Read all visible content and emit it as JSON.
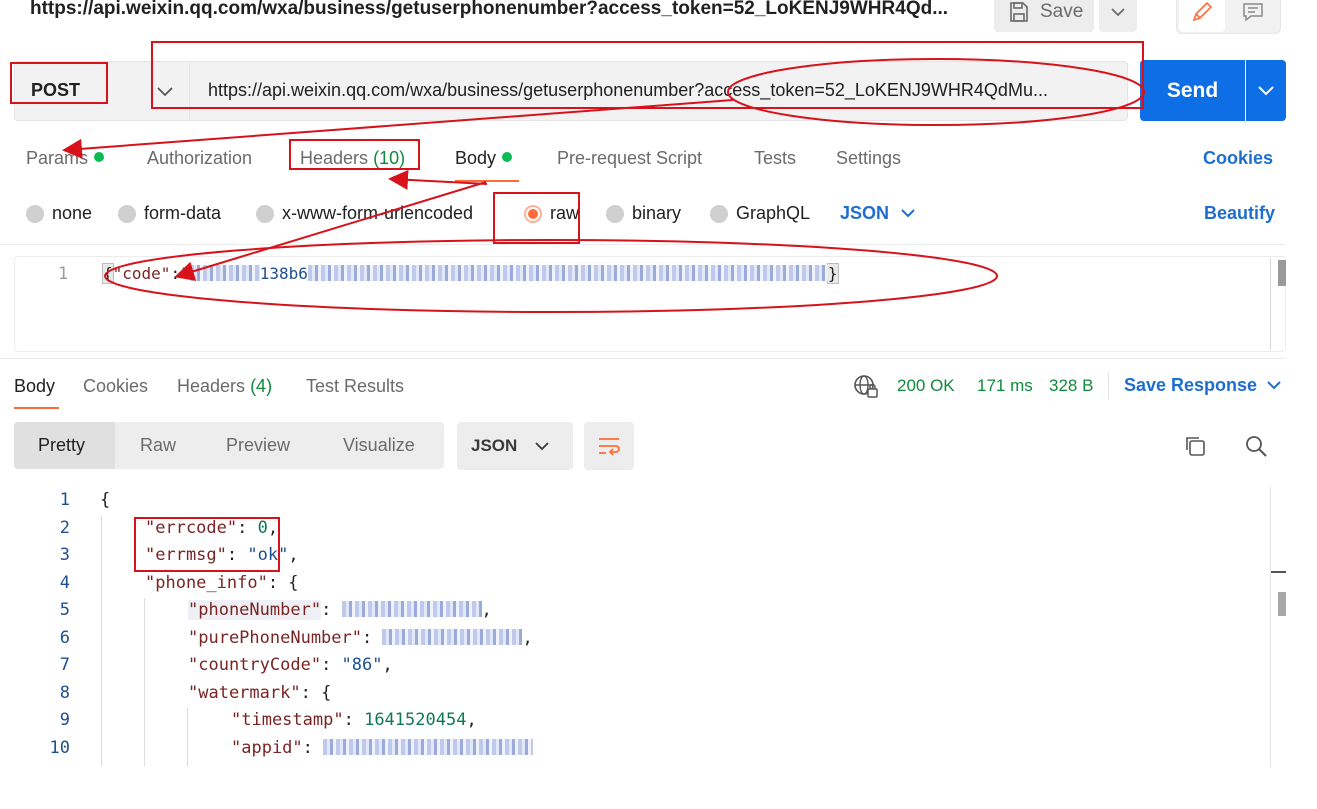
{
  "request_title": "https://api.weixin.qq.com/wxa/business/getuserphonenumber?access_token=52_LoKENJ9WHR4Qd...",
  "toolbar": {
    "save_label": "Save"
  },
  "request": {
    "method": "POST",
    "url": "https://api.weixin.qq.com/wxa/business/getuserphonenumber?access_token=52_LoKENJ9WHR4QdMu...",
    "send_label": "Send"
  },
  "request_tabs": {
    "params": "Params",
    "authorization": "Authorization",
    "headers": "Headers",
    "headers_count": "(10)",
    "body": "Body",
    "pre_request": "Pre-request Script",
    "tests": "Tests",
    "settings": "Settings",
    "cookies": "Cookies"
  },
  "body_types": {
    "none": "none",
    "form_data": "form-data",
    "urlencoded": "x-www-form-urlencoded",
    "raw": "raw",
    "binary": "binary",
    "graphql": "GraphQL",
    "format": "JSON",
    "beautify": "Beautify"
  },
  "request_body": {
    "line_number": "1",
    "open": "{",
    "key": "\"code\"",
    "colon": ":",
    "value_start": "\"",
    "value_visible": "138b6",
    "close": "}"
  },
  "response_tabs": {
    "body": "Body",
    "cookies": "Cookies",
    "headers": "Headers",
    "headers_count": "(4)",
    "test_results": "Test Results"
  },
  "response_status": {
    "status": "200 OK",
    "time": "171 ms",
    "size": "328 B",
    "save_response": "Save Response"
  },
  "response_view": {
    "pretty": "Pretty",
    "raw": "Raw",
    "preview": "Preview",
    "visualize": "Visualize",
    "format": "JSON"
  },
  "response_body": {
    "line_numbers": [
      "1",
      "2",
      "3",
      "4",
      "5",
      "6",
      "7",
      "8",
      "9",
      "10"
    ],
    "brace_open": "{",
    "errcode_key": "\"errcode\"",
    "errcode_value": "0",
    "errmsg_key": "\"errmsg\"",
    "errmsg_value": "\"ok\"",
    "phone_info_key": "\"phone_info\"",
    "phone_number_key": "\"phoneNumber\"",
    "pure_phone_number_key": "\"purePhoneNumber\"",
    "country_code_key": "\"countryCode\"",
    "country_code_value": "\"86\"",
    "watermark_key": "\"watermark\"",
    "timestamp_key": "\"timestamp\"",
    "timestamp_value": "1641520454",
    "appid_key": "\"appid\""
  },
  "colors": {
    "send_blue": "#0d6ee5",
    "link_blue": "#1d6fcf",
    "accent_orange": "#ff6c37",
    "status_green": "#0f8a3c",
    "annotation_red": "#d8121b"
  }
}
